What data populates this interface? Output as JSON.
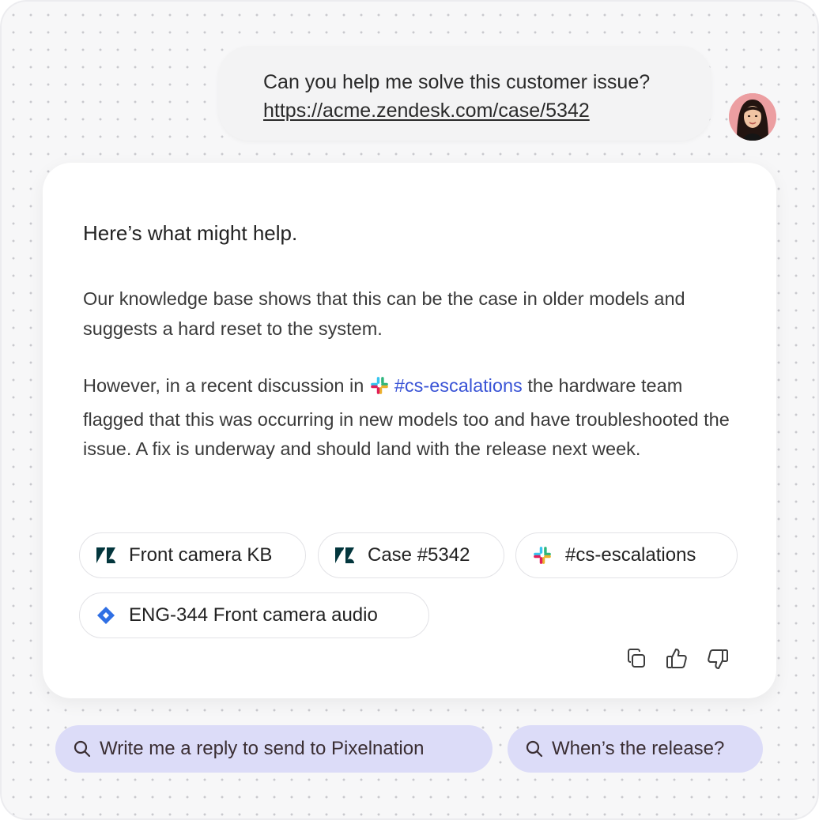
{
  "user_message": {
    "text": "Can you help me solve this customer issue?",
    "link": "https://acme.zendesk.com/case/5342"
  },
  "assistant": {
    "heading": "Here’s what might help.",
    "paragraph1": "Our knowledge base shows that this can be the case in older models and suggests a hard reset to the system.",
    "paragraph2_before": "However, in a recent discussion in ",
    "channel": "#cs-escalations",
    "paragraph2_after": " the hardware team flagged that this was occurring in new models too and have troubleshooted the issue. A fix is underway and should land with the release next week.",
    "sources": [
      {
        "label": "Front camera KB",
        "icon": "zendesk-icon"
      },
      {
        "label": "Case #5342",
        "icon": "zendesk-icon"
      },
      {
        "label": "#cs-escalations",
        "icon": "slack-icon"
      },
      {
        "label": "ENG-344 Front camera audio",
        "icon": "jira-icon"
      }
    ],
    "actions": [
      "copy-icon",
      "thumbs-up-icon",
      "thumbs-down-icon"
    ]
  },
  "suggestions": [
    {
      "label": "Write me a reply to send to Pixelnation",
      "icon": "search-icon"
    },
    {
      "label": "When’s the release?",
      "icon": "search-icon"
    }
  ],
  "colors": {
    "link_blue": "#3a54d6",
    "suggestion_bg": "#dcdcf8",
    "jira_blue": "#2f6fe4",
    "zendesk_dark": "#03363d"
  }
}
